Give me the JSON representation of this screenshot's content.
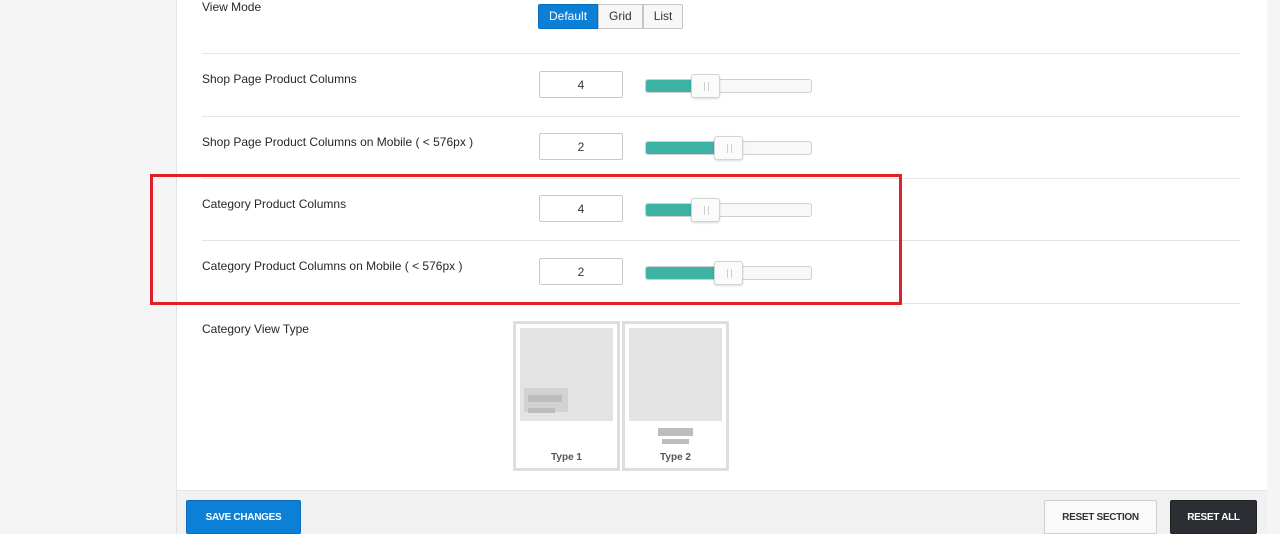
{
  "options": {
    "view_mode": {
      "label": "View Mode",
      "buttons": [
        "Default",
        "Grid",
        "List"
      ],
      "selected": "Default"
    },
    "shop_columns": {
      "label": "Shop Page Product Columns",
      "value": "4",
      "slider_fraction": 0.33
    },
    "shop_columns_mobile": {
      "label": "Shop Page Product Columns on Mobile ( < 576px )",
      "value": "2",
      "slider_fraction": 0.5
    },
    "category_columns": {
      "label": "Category Product Columns",
      "value": "4",
      "slider_fraction": 0.33
    },
    "category_columns_mobile": {
      "label": "Category Product Columns on Mobile ( < 576px )",
      "value": "2",
      "slider_fraction": 0.5
    },
    "category_view_type": {
      "label": "Category View Type",
      "types": [
        "Type 1",
        "Type 2"
      ]
    }
  },
  "footer": {
    "save_label": "SAVE CHANGES",
    "reset_section_label": "RESET SECTION",
    "reset_all_label": "RESET ALL"
  },
  "colors": {
    "accent_blue": "#0c7fd6",
    "slider_fill": "#3db3a5",
    "highlight_red": "#e0202a",
    "dark_button": "#2b2f33"
  }
}
